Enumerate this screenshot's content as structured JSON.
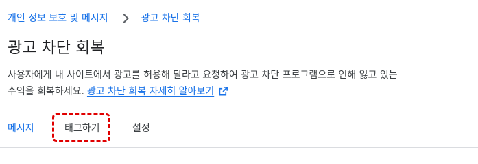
{
  "breadcrumb": {
    "parent_label": "개인 정보 보호 및 메시지",
    "current_label": "광고 차단 회복"
  },
  "page": {
    "title": "광고 차단 회복",
    "description_line1": "사용자에게 내 사이트에서 광고를 허용해 달라고 요청하여 광고 차단 프로그램으로 인해 잃고 있는",
    "description_line2": "수익을 회복하세요.",
    "learn_more_label": "광고 차단 회복 자세히 알아보기"
  },
  "tabs": [
    {
      "label": "메시지",
      "active": true
    },
    {
      "label": "태그하기",
      "active": false
    },
    {
      "label": "설정",
      "active": false
    }
  ],
  "colors": {
    "link": "#1a73e8",
    "highlight": "#e00000"
  },
  "icons": {
    "separator": "chevron-right-icon",
    "learn_more": "open-in-new-icon"
  }
}
